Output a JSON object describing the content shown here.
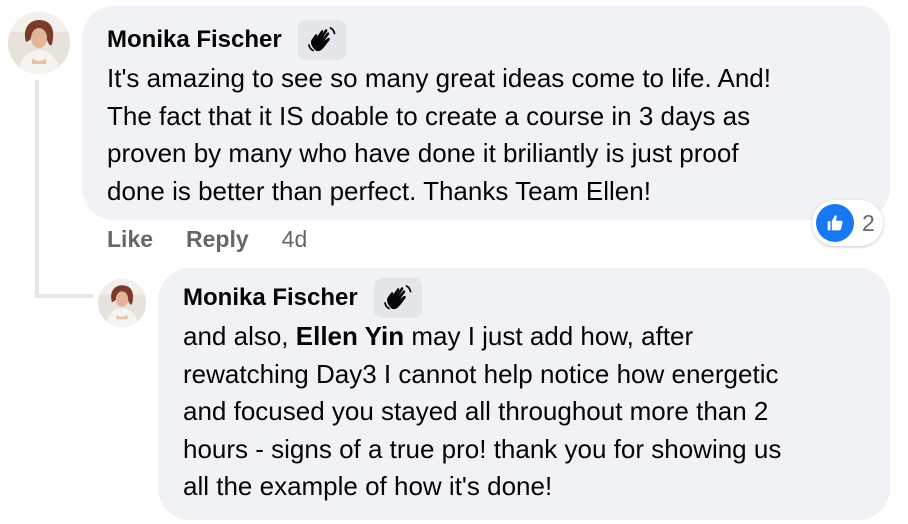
{
  "comment": {
    "author": "Monika Fischer",
    "badge_icon": "waving-hand-icon",
    "lines": [
      "It's amazing to see so many great ideas come to life. And!",
      "The fact that it IS doable to create a course in 3 days as",
      "proven by many who have done it briliantly is just proof",
      "done is better than perfect. Thanks Team Ellen!"
    ],
    "actions": {
      "like_label": "Like",
      "reply_label": "Reply",
      "timestamp": "4d"
    },
    "reactions": {
      "icon": "thumbs-up-icon",
      "color": "#1877f2",
      "count": "2"
    }
  },
  "reply": {
    "author": "Monika Fischer",
    "badge_icon": "waving-hand-icon",
    "line1_prefix": "and also, ",
    "mention": "Ellen Yin",
    "line1_suffix": " may I just add how, after",
    "lines": [
      "rewatching Day3 I cannot help notice how energetic",
      "and focused you stayed all throughout more than 2",
      "hours - signs of a true pro! thank you for showing us",
      "all the example of how it's done!"
    ]
  },
  "colors": {
    "bubble": "#f0f2f5",
    "secondary_text": "#65676b",
    "thread_line": "#e4e6eb"
  }
}
